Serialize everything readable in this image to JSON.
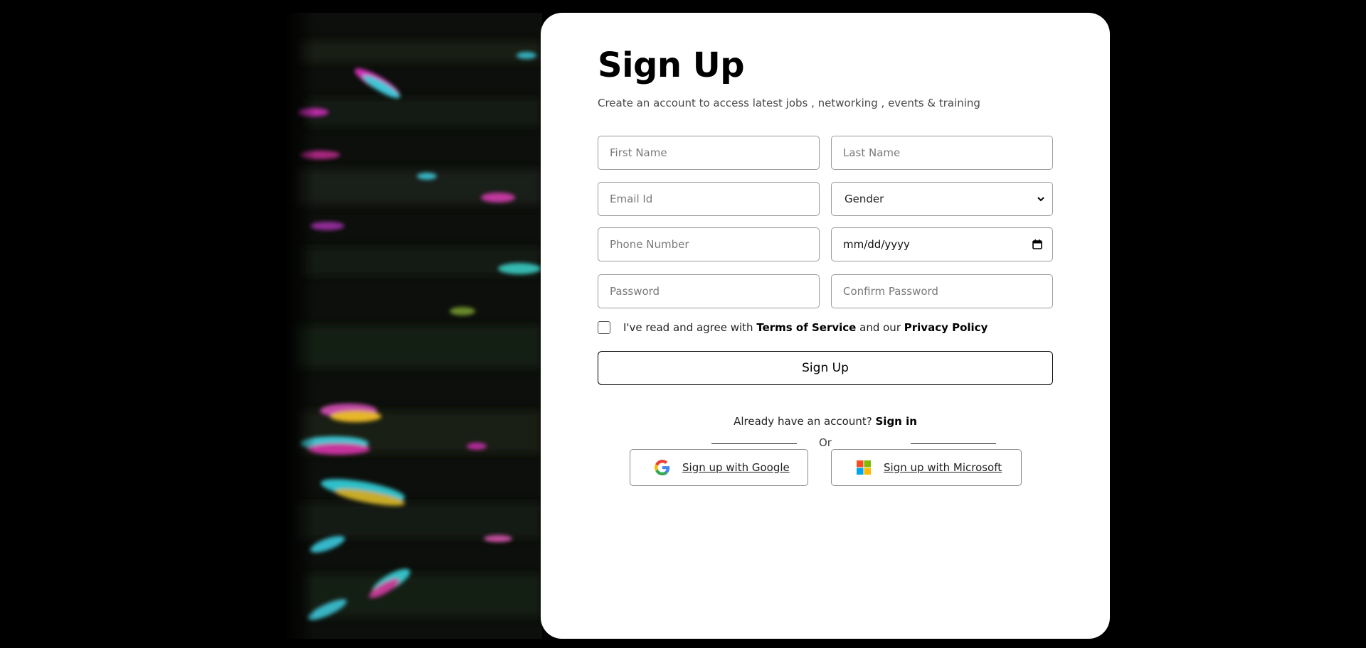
{
  "form": {
    "title": "Sign Up",
    "subtitle": "Create an account to access latest jobs , networking , events & training",
    "first_name_placeholder": "First Name",
    "last_name_placeholder": "Last Name",
    "email_placeholder": "Email Id",
    "gender_selected": "Gender",
    "phone_placeholder": "Phone Number",
    "date_value": "mm/dd/yyyy",
    "password_placeholder": "Password",
    "confirm_password_placeholder": "Confirm Password",
    "terms": {
      "prefix": "I've read and agree with",
      "terms_link": "Terms of Service",
      "middle": "and our",
      "privacy_link": "Privacy Policy",
      "checked": false
    },
    "submit_label": "Sign Up"
  },
  "signin": {
    "prompt": "Already have an account?",
    "link": "Sign in"
  },
  "divider": {
    "label": "Or"
  },
  "social": {
    "google_label": "Sign up with Google",
    "google_icon": "google-icon",
    "microsoft_label": "Sign up with Microsoft",
    "microsoft_icon": "microsoft-icon"
  },
  "colors": {
    "background": "#000000",
    "card": "#ffffff",
    "text": "#000000",
    "border": "#9a9a9a"
  }
}
